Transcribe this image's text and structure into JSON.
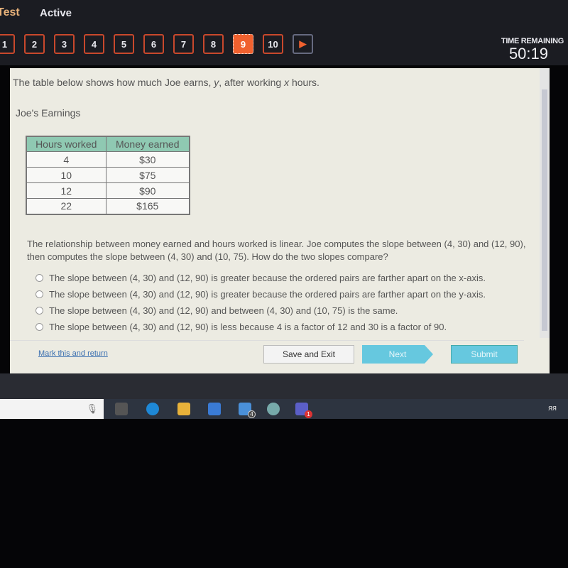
{
  "header": {
    "app_title": "Test",
    "status": "Active",
    "time_label": "TIME REMAINING",
    "time_value": "50:19"
  },
  "question_nav": {
    "items": [
      "1",
      "2",
      "3",
      "4",
      "5",
      "6",
      "7",
      "8",
      "9",
      "10"
    ],
    "current": "9",
    "next_arrow": "▶"
  },
  "question": {
    "prompt_parts": [
      "The table below shows how much Joe earns, ",
      "y",
      ", after working ",
      "x",
      " hours."
    ],
    "table_title": "Joe's Earnings",
    "table": {
      "headers": [
        "Hours worked",
        "Money earned"
      ],
      "rows": [
        [
          "4",
          "$30"
        ],
        [
          "10",
          "$75"
        ],
        [
          "12",
          "$90"
        ],
        [
          "22",
          "$165"
        ]
      ]
    },
    "text": "The relationship between money earned and hours worked is linear. Joe computes the slope between (4, 30) and (12, 90), then computes the slope between (4, 30) and (10, 75). How do the two slopes compare?",
    "options": [
      "The slope between (4, 30) and (12, 90) is greater because the ordered pairs are farther apart on the x-axis.",
      "The slope between (4, 30) and (12, 90) is greater because the ordered pairs are farther apart on the y-axis.",
      "The slope between (4, 30) and (12, 90) and between (4, 30) and (10, 75) is the same.",
      "The slope between (4, 30) and (12, 90) is less because 4 is a factor of 12 and 30 is a factor of 90."
    ]
  },
  "footer": {
    "mark": "Mark this and return",
    "save": "Save and Exit",
    "next": "Next",
    "submit": "Submit"
  },
  "taskbar": {
    "mail_badge": "4",
    "teams_badge": "1",
    "colors": {
      "accent": "#f0612f",
      "button": "#66c8df",
      "table_header": "#8fc9b2"
    }
  }
}
